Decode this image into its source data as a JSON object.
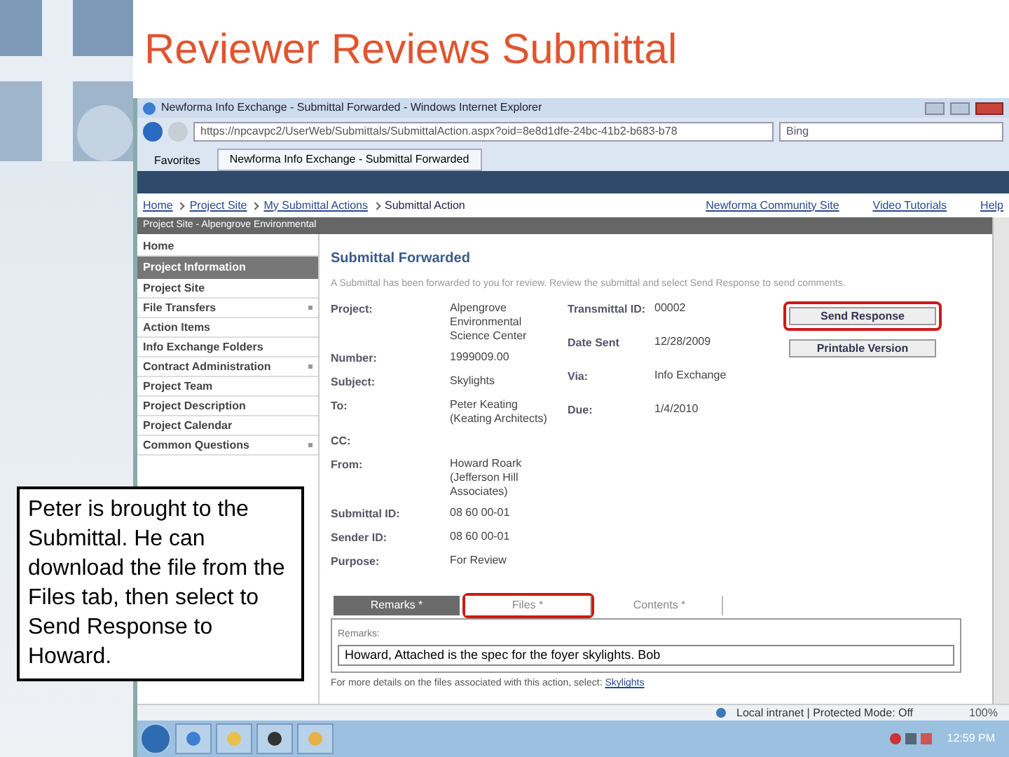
{
  "slide": {
    "title": "Reviewer Reviews Submittal",
    "callout": "Peter is brought to the Submittal. He can download the file from the Files tab, then select to Send Response to Howard."
  },
  "browser": {
    "window_title": "Newforma Info Exchange - Submittal Forwarded - Windows Internet Explorer",
    "address": "https://npcavpc2/UserWeb/Submittals/SubmittalAction.aspx?oid=8e8d1dfe-24bc-41b2-b683-b78",
    "search_placeholder": "Bing",
    "favorites": "Favorites",
    "tab": "Newforma Info Exchange - Submittal Forwarded"
  },
  "breadcrumb": [
    "Home",
    "Project Site",
    "My Submittal Actions",
    "Submittal Action"
  ],
  "header_links": [
    "Newforma Community Site",
    "Video Tutorials",
    "Help"
  ],
  "project_bar": "Project Site - Alpengrove Environmental",
  "sidebar": {
    "items": [
      {
        "label": "Home",
        "kind": "link",
        "expandable": false
      },
      {
        "label": "Project Information",
        "kind": "section",
        "expandable": false
      },
      {
        "label": "Project Site",
        "kind": "link",
        "expandable": false
      },
      {
        "label": "File Transfers",
        "kind": "link",
        "expandable": true
      },
      {
        "label": "Action Items",
        "kind": "link",
        "expandable": false
      },
      {
        "label": "Info Exchange Folders",
        "kind": "link",
        "expandable": false
      },
      {
        "label": "Contract Administration",
        "kind": "link",
        "expandable": true
      },
      {
        "label": "Project Team",
        "kind": "link",
        "expandable": false
      },
      {
        "label": "Project Description",
        "kind": "link",
        "expandable": false
      },
      {
        "label": "Project Calendar",
        "kind": "link",
        "expandable": false
      },
      {
        "label": "Common Questions",
        "kind": "link",
        "expandable": true
      }
    ]
  },
  "main": {
    "title": "Submittal Forwarded",
    "intro": "A Submittal has been forwarded to you for review. Review the submittal and select Send Response to send comments.",
    "fields": [
      {
        "label": "Project:",
        "value": "Alpengrove Environmental Science Center"
      },
      {
        "label": "Number:",
        "value": "1999009.00"
      },
      {
        "label": "Subject:",
        "value": "Skylights"
      },
      {
        "label": "To:",
        "value": "Peter Keating (Keating Architects)"
      },
      {
        "label": "CC:"
      },
      {
        "label": "From:",
        "value": "Howard Roark (Jefferson Hill Associates)"
      },
      {
        "label": "Submittal ID:",
        "value": "08 60 00-01"
      },
      {
        "label": "Sender ID:",
        "value": "08 60 00-01"
      },
      {
        "label": "Purpose:",
        "value": "For Review"
      }
    ],
    "fields_right": [
      {
        "label": "Transmittal ID:",
        "value": "00002"
      },
      {
        "label": "Date Sent",
        "value": "12/28/2009"
      },
      {
        "label": "Via:",
        "value": "Info Exchange"
      },
      {
        "label": "Due:",
        "value": "1/4/2010"
      }
    ],
    "buttons": [
      {
        "label": "Send Response",
        "highlighted": true
      },
      {
        "label": "Printable Version",
        "highlighted": false
      }
    ],
    "tabs": [
      {
        "label": "Remarks *",
        "selected": true,
        "highlighted": false
      },
      {
        "label": "Files *",
        "selected": false,
        "highlighted": true
      },
      {
        "label": "Contents *",
        "selected": false,
        "highlighted": false
      }
    ],
    "remarks_label": "Remarks:",
    "remarks_value": "Howard, Attached is the spec for the foyer skylights.  Bob",
    "footer_text": "For more details on the files associated with this action, select:",
    "footer_link": "Skylights"
  },
  "status_bar": {
    "zone": "Local intranet | Protected Mode: Off",
    "zoom": "100%"
  },
  "taskbar": {
    "clock": "12:59 PM"
  }
}
